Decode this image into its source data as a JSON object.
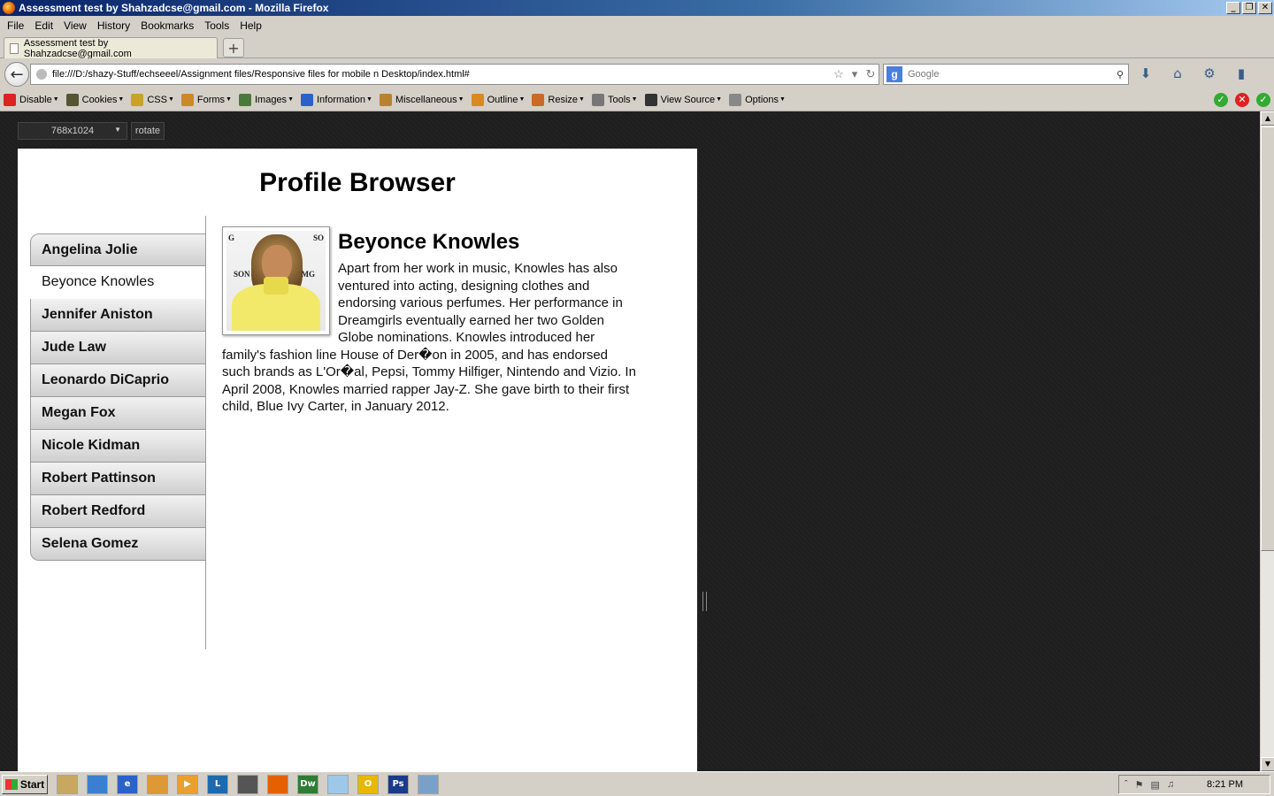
{
  "window": {
    "title": "Assessment test by Shahzadcse@gmail.com - Mozilla Firefox",
    "buttons": [
      "_",
      "❐",
      "✕"
    ]
  },
  "menu": [
    "File",
    "Edit",
    "View",
    "History",
    "Bookmarks",
    "Tools",
    "Help"
  ],
  "tab": {
    "label": "Assessment test by Shahzadcse@gmail.com",
    "new_tab": "+"
  },
  "nav": {
    "url": "file:///D:/shazy-Stuff/echseeel/Assignment files/Responsive files for mobile n Desktop/index.html#",
    "search_placeholder": "Google"
  },
  "devtoolbar": {
    "items": [
      {
        "label": "Disable",
        "icon": "disable-icon",
        "color": "#d22"
      },
      {
        "label": "Cookies",
        "icon": "cookies-icon",
        "color": "#553"
      },
      {
        "label": "CSS",
        "icon": "css-icon",
        "color": "#c9a227"
      },
      {
        "label": "Forms",
        "icon": "forms-icon",
        "color": "#c98a27"
      },
      {
        "label": "Images",
        "icon": "images-icon",
        "color": "#4a7a3a"
      },
      {
        "label": "Information",
        "icon": "information-icon",
        "color": "#2a62c9"
      },
      {
        "label": "Miscellaneous",
        "icon": "miscellaneous-icon",
        "color": "#b8822e"
      },
      {
        "label": "Outline",
        "icon": "outline-icon",
        "color": "#d98a1f"
      },
      {
        "label": "Resize",
        "icon": "resize-icon",
        "color": "#c96a27"
      },
      {
        "label": "Tools",
        "icon": "tools-icon",
        "color": "#777"
      },
      {
        "label": "View Source",
        "icon": "view-source-icon",
        "color": "#333"
      },
      {
        "label": "Options",
        "icon": "options-icon",
        "color": "#888"
      }
    ]
  },
  "viewport": {
    "size": "768x1024",
    "rotate": "rotate"
  },
  "page": {
    "title": "Profile Browser",
    "profiles": [
      "Angelina Jolie",
      "Beyonce Knowles",
      "Jennifer Aniston",
      "Jude Law",
      "Leonardo DiCaprio",
      "Megan Fox",
      "Nicole Kidman",
      "Robert Pattinson",
      "Robert Redford",
      "Selena Gomez"
    ],
    "active_index": 1,
    "selected": {
      "name": "Beyonce Knowles",
      "bio": "Apart from her work in music, Knowles has also ventured into acting, designing clothes and endorsing various perfumes. Her performance in Dreamgirls eventually earned her two Golden Globe nominations. Knowles introduced her family's fashion line House of Der�on in 2005, and has endorsed such brands as L'Or�al, Pepsi, Tommy Hilfiger, Nintendo and Vizio. In April 2008, Knowles married rapper Jay-Z. She gave birth to their first child, Blue Ivy Carter, in January 2012.",
      "photo_text": [
        "G",
        "SO",
        "SON",
        "MG"
      ]
    }
  },
  "taskbar": {
    "start": "Start",
    "apps": [
      "",
      "",
      "e",
      "",
      "▶",
      "L",
      "",
      "",
      "Dw",
      "",
      "O",
      "Ps",
      ""
    ],
    "time": "8:21 PM"
  }
}
